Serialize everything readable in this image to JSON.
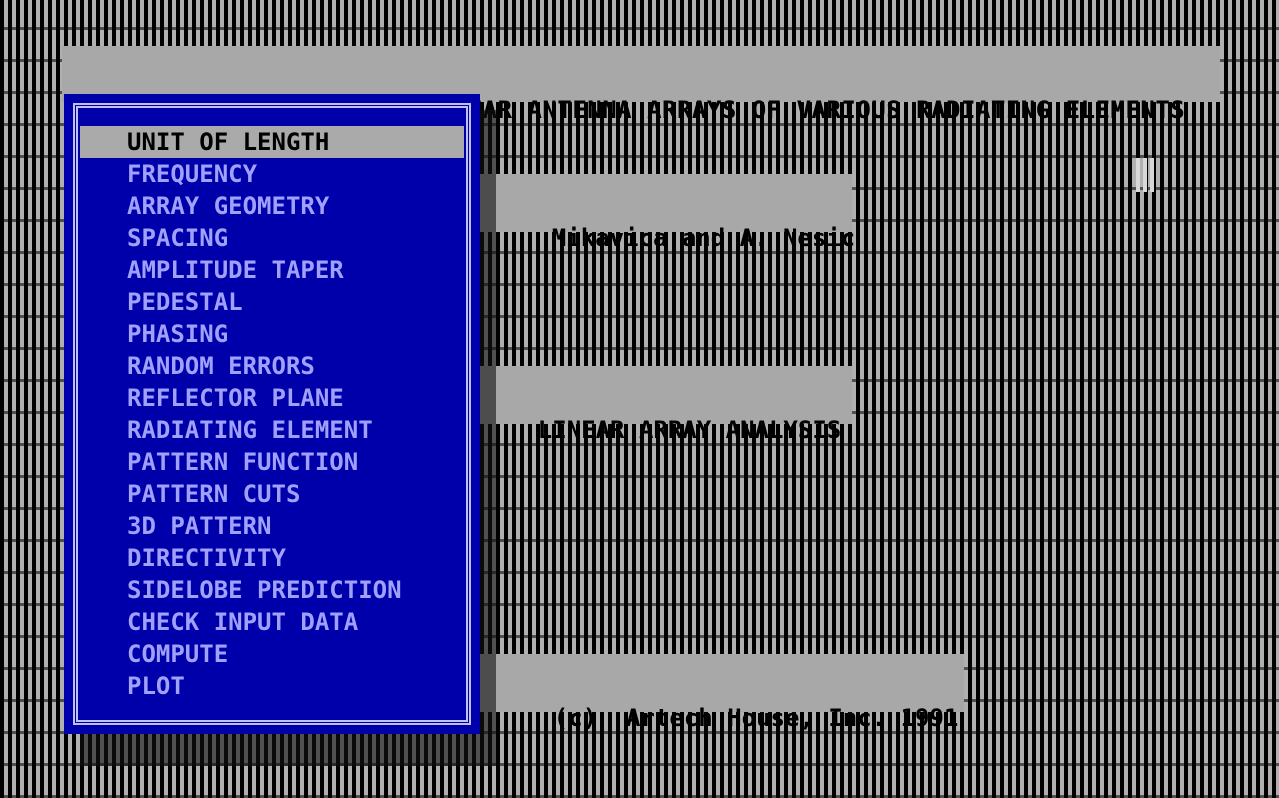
{
  "header": {
    "title": "CAD FOR LINEAR AND PLANAR ANTENNA ARRAYS OF VARIOUS RADIATING ELEMENTS"
  },
  "background_boxes": {
    "authors": "Mikavica and A. Nesic",
    "subtitle": "LINEAR ARRAY ANALYSIS",
    "copyright": "(c)  Artech House, Inc. 1991"
  },
  "menu": {
    "selected_index": 0,
    "items": [
      {
        "label": "UNIT OF LENGTH"
      },
      {
        "label": "FREQUENCY"
      },
      {
        "label": "ARRAY GEOMETRY"
      },
      {
        "label": "SPACING"
      },
      {
        "label": "AMPLITUDE TAPER"
      },
      {
        "label": "PEDESTAL"
      },
      {
        "label": "PHASING"
      },
      {
        "label": "RANDOM ERRORS"
      },
      {
        "label": "REFLECTOR PLANE"
      },
      {
        "label": "RADIATING ELEMENT"
      },
      {
        "label": "PATTERN FUNCTION"
      },
      {
        "label": "PATTERN CUTS"
      },
      {
        "label": "3D PATTERN"
      },
      {
        "label": "DIRECTIVITY"
      },
      {
        "label": "SIDELOBE PREDICTION"
      },
      {
        "label": "CHECK INPUT DATA"
      },
      {
        "label": "COMPUTE"
      },
      {
        "label": "PLOT"
      }
    ]
  },
  "colors": {
    "menu_background": "#0000aa",
    "menu_text": "#a0a0ff",
    "highlight_background": "#aaaaaa",
    "panel_background": "#a8a8a8"
  },
  "icons": {
    "cursor": "mouse-cursor-block"
  }
}
